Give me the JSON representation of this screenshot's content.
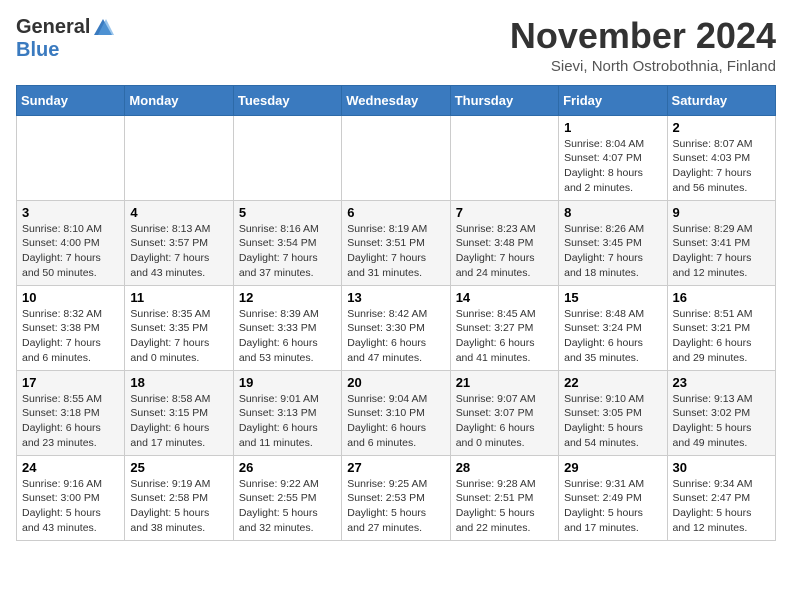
{
  "logo": {
    "general": "General",
    "blue": "Blue"
  },
  "title": {
    "month": "November 2024",
    "location": "Sievi, North Ostrobothnia, Finland"
  },
  "headers": [
    "Sunday",
    "Monday",
    "Tuesday",
    "Wednesday",
    "Thursday",
    "Friday",
    "Saturday"
  ],
  "weeks": [
    [
      {
        "day": "",
        "info": ""
      },
      {
        "day": "",
        "info": ""
      },
      {
        "day": "",
        "info": ""
      },
      {
        "day": "",
        "info": ""
      },
      {
        "day": "",
        "info": ""
      },
      {
        "day": "1",
        "info": "Sunrise: 8:04 AM\nSunset: 4:07 PM\nDaylight: 8 hours\nand 2 minutes."
      },
      {
        "day": "2",
        "info": "Sunrise: 8:07 AM\nSunset: 4:03 PM\nDaylight: 7 hours\nand 56 minutes."
      }
    ],
    [
      {
        "day": "3",
        "info": "Sunrise: 8:10 AM\nSunset: 4:00 PM\nDaylight: 7 hours\nand 50 minutes."
      },
      {
        "day": "4",
        "info": "Sunrise: 8:13 AM\nSunset: 3:57 PM\nDaylight: 7 hours\nand 43 minutes."
      },
      {
        "day": "5",
        "info": "Sunrise: 8:16 AM\nSunset: 3:54 PM\nDaylight: 7 hours\nand 37 minutes."
      },
      {
        "day": "6",
        "info": "Sunrise: 8:19 AM\nSunset: 3:51 PM\nDaylight: 7 hours\nand 31 minutes."
      },
      {
        "day": "7",
        "info": "Sunrise: 8:23 AM\nSunset: 3:48 PM\nDaylight: 7 hours\nand 24 minutes."
      },
      {
        "day": "8",
        "info": "Sunrise: 8:26 AM\nSunset: 3:45 PM\nDaylight: 7 hours\nand 18 minutes."
      },
      {
        "day": "9",
        "info": "Sunrise: 8:29 AM\nSunset: 3:41 PM\nDaylight: 7 hours\nand 12 minutes."
      }
    ],
    [
      {
        "day": "10",
        "info": "Sunrise: 8:32 AM\nSunset: 3:38 PM\nDaylight: 7 hours\nand 6 minutes."
      },
      {
        "day": "11",
        "info": "Sunrise: 8:35 AM\nSunset: 3:35 PM\nDaylight: 7 hours\nand 0 minutes."
      },
      {
        "day": "12",
        "info": "Sunrise: 8:39 AM\nSunset: 3:33 PM\nDaylight: 6 hours\nand 53 minutes."
      },
      {
        "day": "13",
        "info": "Sunrise: 8:42 AM\nSunset: 3:30 PM\nDaylight: 6 hours\nand 47 minutes."
      },
      {
        "day": "14",
        "info": "Sunrise: 8:45 AM\nSunset: 3:27 PM\nDaylight: 6 hours\nand 41 minutes."
      },
      {
        "day": "15",
        "info": "Sunrise: 8:48 AM\nSunset: 3:24 PM\nDaylight: 6 hours\nand 35 minutes."
      },
      {
        "day": "16",
        "info": "Sunrise: 8:51 AM\nSunset: 3:21 PM\nDaylight: 6 hours\nand 29 minutes."
      }
    ],
    [
      {
        "day": "17",
        "info": "Sunrise: 8:55 AM\nSunset: 3:18 PM\nDaylight: 6 hours\nand 23 minutes."
      },
      {
        "day": "18",
        "info": "Sunrise: 8:58 AM\nSunset: 3:15 PM\nDaylight: 6 hours\nand 17 minutes."
      },
      {
        "day": "19",
        "info": "Sunrise: 9:01 AM\nSunset: 3:13 PM\nDaylight: 6 hours\nand 11 minutes."
      },
      {
        "day": "20",
        "info": "Sunrise: 9:04 AM\nSunset: 3:10 PM\nDaylight: 6 hours\nand 6 minutes."
      },
      {
        "day": "21",
        "info": "Sunrise: 9:07 AM\nSunset: 3:07 PM\nDaylight: 6 hours\nand 0 minutes."
      },
      {
        "day": "22",
        "info": "Sunrise: 9:10 AM\nSunset: 3:05 PM\nDaylight: 5 hours\nand 54 minutes."
      },
      {
        "day": "23",
        "info": "Sunrise: 9:13 AM\nSunset: 3:02 PM\nDaylight: 5 hours\nand 49 minutes."
      }
    ],
    [
      {
        "day": "24",
        "info": "Sunrise: 9:16 AM\nSunset: 3:00 PM\nDaylight: 5 hours\nand 43 minutes."
      },
      {
        "day": "25",
        "info": "Sunrise: 9:19 AM\nSunset: 2:58 PM\nDaylight: 5 hours\nand 38 minutes."
      },
      {
        "day": "26",
        "info": "Sunrise: 9:22 AM\nSunset: 2:55 PM\nDaylight: 5 hours\nand 32 minutes."
      },
      {
        "day": "27",
        "info": "Sunrise: 9:25 AM\nSunset: 2:53 PM\nDaylight: 5 hours\nand 27 minutes."
      },
      {
        "day": "28",
        "info": "Sunrise: 9:28 AM\nSunset: 2:51 PM\nDaylight: 5 hours\nand 22 minutes."
      },
      {
        "day": "29",
        "info": "Sunrise: 9:31 AM\nSunset: 2:49 PM\nDaylight: 5 hours\nand 17 minutes."
      },
      {
        "day": "30",
        "info": "Sunrise: 9:34 AM\nSunset: 2:47 PM\nDaylight: 5 hours\nand 12 minutes."
      }
    ]
  ]
}
